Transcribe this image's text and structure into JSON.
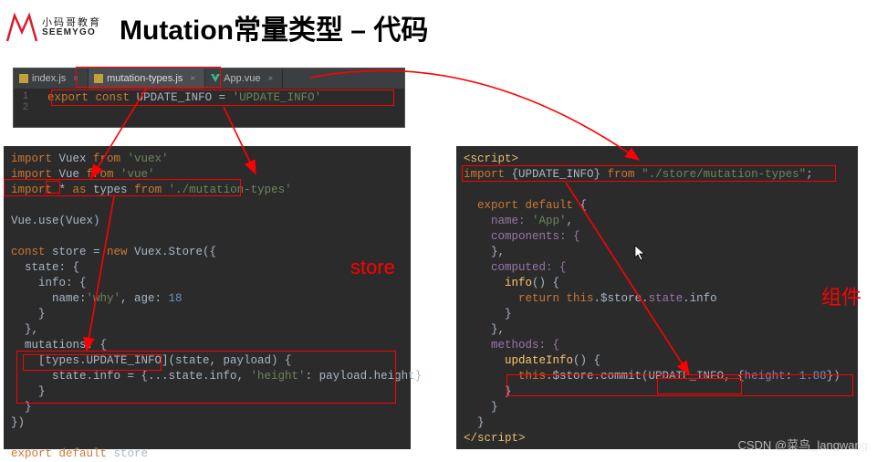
{
  "logo": {
    "cn": "小码哥教育",
    "en": "SEEMYGO"
  },
  "title": "Mutation常量类型 – 代码",
  "tabs": [
    {
      "label": "index.js",
      "active": false
    },
    {
      "label": "mutation-types.js",
      "active": true
    },
    {
      "label": "App.vue",
      "active": false
    }
  ],
  "top_code": {
    "line_nums": [
      "1",
      "2"
    ],
    "line1": {
      "kw1": "export",
      "kw2": "const",
      "ident": "UPDATE_INFO",
      "eq": " = ",
      "str": "'UPDATE_INFO'"
    }
  },
  "store": {
    "l1": {
      "kw": "import",
      "id": " Vuex ",
      "from": "from",
      "str": " 'vuex'"
    },
    "l2": {
      "kw": "import",
      "id": " Vue ",
      "from": "from",
      "str": " 'vue'"
    },
    "l3": {
      "kw": "import",
      "star": " * ",
      "as": "as",
      "id": " types ",
      "from": "from",
      "str": " './mutation-types'"
    },
    "l5": "Vue.use(Vuex)",
    "l7a": "const",
    "l7b": " store = ",
    "l7c": "new",
    "l7d": " Vuex.Store({",
    "l8": "  state: {",
    "l9": "    info: {",
    "l10a": "      name:",
    "l10b": "'why'",
    "l10c": ", age: ",
    "l10d": "18",
    "l11": "    }",
    "l12": "  },",
    "l13": "  mutations: {",
    "l14": "    [types.UPDATE_INFO](state, payload) {",
    "l15a": "      state.info = {...state.info, ",
    "l15b": "'height'",
    "l15c": ": payload.height}",
    "l16": "    }",
    "l17": "  }",
    "l18": "})",
    "l20a": "export",
    "l20b": " default",
    "l20c": " store"
  },
  "comp": {
    "l1": "<script>",
    "l2a": "import",
    "l2b": " {UPDATE_INFO} ",
    "l2c": "from",
    "l2d": " \"./store/mutation-types\"",
    "l2e": ";",
    "l4a": "  export",
    "l4b": " default",
    "l4c": " {",
    "l5a": "    name: ",
    "l5b": "'App'",
    "l5c": ",",
    "l6": "    components: {",
    "l7": "    },",
    "l8": "    computed: {",
    "l9a": "      ",
    "l9b": "info",
    "l9c": "() {",
    "l10a": "        ",
    "l10b": "return",
    "l10c": " this",
    "l10d": ".$store.",
    "l10e": "state",
    "l10f": ".info",
    "l11": "      }",
    "l12": "    },",
    "l13": "    methods: {",
    "l14a": "      ",
    "l14b": "updateInfo",
    "l14c": "() {",
    "l15a": "        ",
    "l15b": "this",
    "l15c": ".$store.commit(UPDATE_INFO, {",
    "l15d": "height",
    "l15e": ": ",
    "l15f": "1.88",
    "l15g": "})",
    "l16": "      }",
    "l17": "    }",
    "l18": "  }",
    "l19": "</script>"
  },
  "labels": {
    "store": "store",
    "component": "组件"
  },
  "watermark": "CSDN @菜鸟_langwang"
}
